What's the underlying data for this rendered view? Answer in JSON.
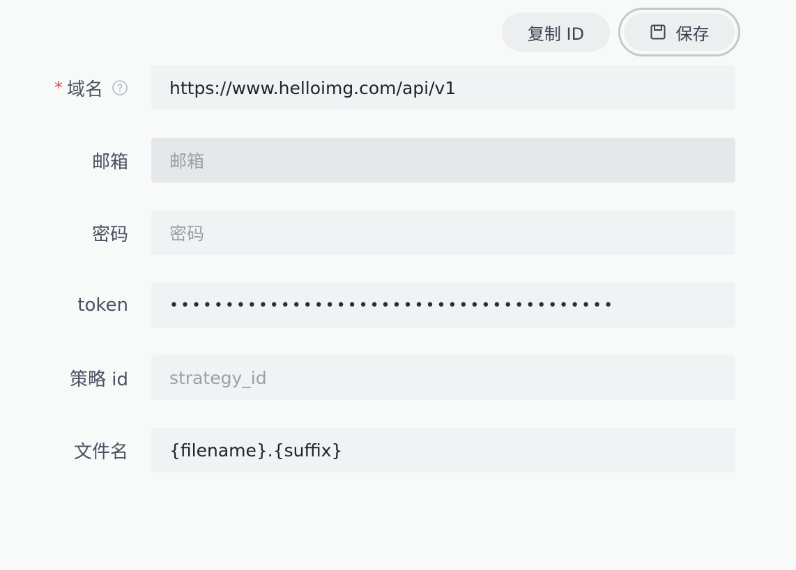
{
  "toolbar": {
    "copy_id_label": "复制 ID",
    "save_label": "保存"
  },
  "form": {
    "domain": {
      "label": "域名",
      "required_mark": "*",
      "value": "https://www.helloimg.com/api/v1"
    },
    "email": {
      "label": "邮箱",
      "placeholder": "邮箱"
    },
    "password": {
      "label": "密码",
      "placeholder": "密码"
    },
    "token": {
      "label": "token",
      "value": "••••••••••••••••••••••••••••••••••••••••"
    },
    "strategy_id": {
      "label": "策略 id",
      "placeholder": "strategy_id"
    },
    "filename": {
      "label": "文件名",
      "value": "{filename}.{suffix}"
    }
  },
  "icons": {
    "save": "save-icon",
    "help": "help-circle-icon"
  },
  "colors": {
    "background": "#f8f9f9",
    "input_background": "#f1f2f4",
    "disabled_input_background": "#e6e7ea",
    "required": "#e5484d",
    "label": "#4a5160",
    "placeholder": "#9aa0a8"
  }
}
